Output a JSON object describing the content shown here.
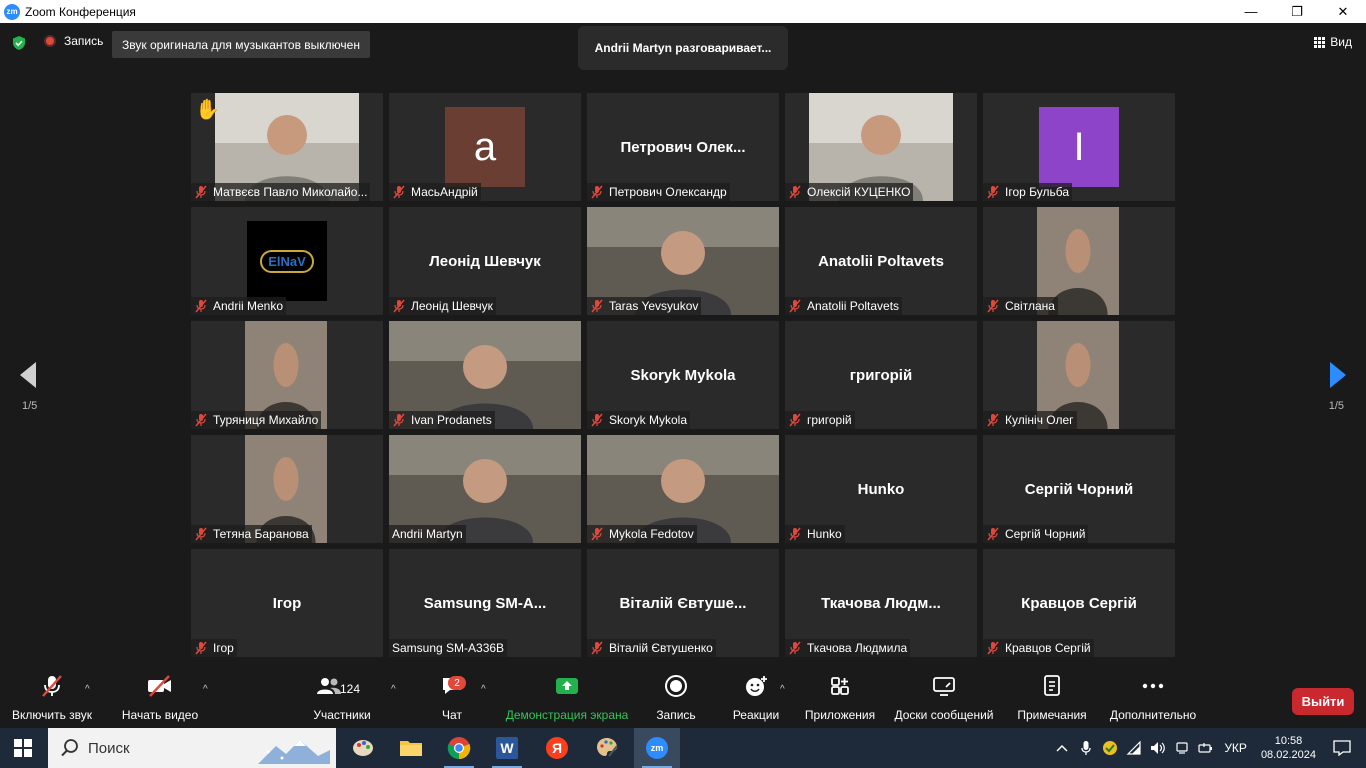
{
  "window": {
    "title": "Zoom Конференция",
    "logo_text": "zm",
    "minimize": "—",
    "maximize": "❐",
    "close": "✕"
  },
  "topbar": {
    "record_label": "Запись",
    "original_sound": "Звук оригинала для музыкантов выключен",
    "speaking": "Andrii Martyn разговаривает...",
    "view_label": "Вид"
  },
  "grid": {
    "page_left": "1/5",
    "page_right": "1/5",
    "tiles": [
      {
        "label": "Матвєєв Павло Миколайо...",
        "display": "",
        "kind": "photo",
        "muted": true,
        "hand": true
      },
      {
        "label": "МасьАндрій",
        "display": "",
        "kind": "letter",
        "letter": "a",
        "muted": true
      },
      {
        "label": "Петрович Олександр",
        "display": "Петрович  Олек...",
        "kind": "name",
        "muted": true
      },
      {
        "label": "Олексій КУЦЕНКО",
        "display": "",
        "kind": "photo",
        "muted": true
      },
      {
        "label": "Ігор Бульба",
        "display": "",
        "kind": "letter",
        "letter": "I",
        "muted": true
      },
      {
        "label": "Andrii Menko",
        "display": "",
        "kind": "logo",
        "logo_text": "ElNaV",
        "muted": true
      },
      {
        "label": "Леонід Шевчук",
        "display": "Леонід Шевчук",
        "kind": "name",
        "muted": true
      },
      {
        "label": "Taras Yevsyukov",
        "display": "",
        "kind": "photo-wide",
        "muted": true
      },
      {
        "label": "Anatolii Poltavets",
        "display": "Anatolii Poltavets",
        "kind": "name",
        "muted": true
      },
      {
        "label": "Світлана",
        "display": "",
        "kind": "photo-narrow",
        "muted": true
      },
      {
        "label": "Туряниця Михайло",
        "display": "",
        "kind": "photo-narrow",
        "muted": true
      },
      {
        "label": "Ivan Prodanets",
        "display": "",
        "kind": "photo-wide",
        "muted": true
      },
      {
        "label": "Skoryk Mykola",
        "display": "Skoryk Mykola",
        "kind": "name",
        "muted": true
      },
      {
        "label": "григорій",
        "display": "григорій",
        "kind": "name",
        "muted": true
      },
      {
        "label": "Кулініч Олег",
        "display": "",
        "kind": "photo-narrow",
        "muted": true
      },
      {
        "label": "Тетяна Баранова",
        "display": "",
        "kind": "photo-narrow",
        "muted": true
      },
      {
        "label": "Andrii Martyn",
        "display": "",
        "kind": "photo-wide",
        "muted": false,
        "active": true
      },
      {
        "label": "Mykola Fedotov",
        "display": "",
        "kind": "photo-wide",
        "muted": true
      },
      {
        "label": "Hunko",
        "display": "Hunko",
        "kind": "name",
        "muted": true
      },
      {
        "label": "Сергій Чорний",
        "display": "Сергій Чорний",
        "kind": "name",
        "muted": true
      },
      {
        "label": "Ігор",
        "display": "Ігор",
        "kind": "name",
        "muted": true
      },
      {
        "label": "Samsung SM-A336B",
        "display": "Samsung  SM-A...",
        "kind": "name",
        "muted": false
      },
      {
        "label": "Віталій Євтушенко",
        "display": "Віталій Євтуше...",
        "kind": "name",
        "muted": true
      },
      {
        "label": "Ткачова Людмила",
        "display": "Ткачова  Людм...",
        "kind": "name",
        "muted": true
      },
      {
        "label": "Кравцов Сергій",
        "display": "Кравцов Сергій",
        "kind": "name",
        "muted": true
      }
    ]
  },
  "toolbar": {
    "unmute": "Включить звук",
    "start_video": "Начать видео",
    "participants": "Участники",
    "participants_count": "124",
    "chat": "Чат",
    "chat_badge": "2",
    "share": "Демонстрация экрана",
    "record": "Запись",
    "reactions": "Реакции",
    "apps": "Приложения",
    "whiteboards": "Доски сообщений",
    "notes": "Примечания",
    "more": "Дополнительно",
    "leave": "Выйти"
  },
  "taskbar": {
    "search_placeholder": "Поиск",
    "lang": "УКР",
    "time": "10:58",
    "date": "08.02.2024",
    "word_letter": "W",
    "yandex_letter": "Я",
    "zoom_letter": "zm"
  },
  "colors": {
    "accent_green": "#33c45a",
    "leave_red": "#c8282e",
    "active_speaker": "#d6e84a",
    "zoom_blue": "#2d8cff"
  }
}
